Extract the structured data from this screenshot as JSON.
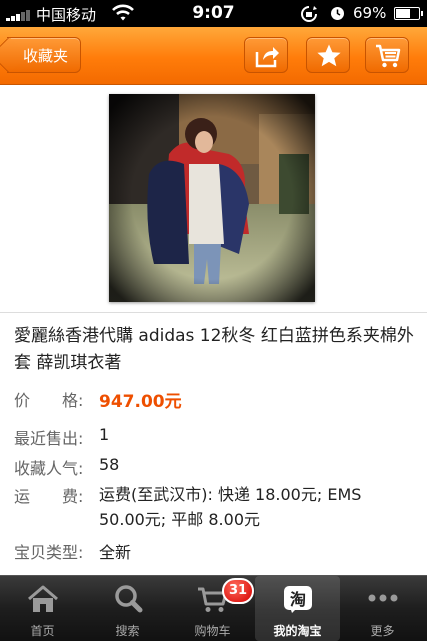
{
  "status_bar": {
    "carrier": "中国移动",
    "time": "9:07",
    "battery": "69%",
    "battery_level": 0.69
  },
  "nav": {
    "back_label": "收藏夹",
    "share_icon": "share-icon",
    "favorite_icon": "star-icon",
    "cart_icon": "cart-icon"
  },
  "product": {
    "image_icon": "product-photo",
    "title": "愛麗絲香港代購 adidas 12秋冬 红白蓝拼色系夹棉外套 薛凯琪衣著",
    "price_label": "价　　格:",
    "price": "947.00元",
    "recent_sold_label": "最近售出:",
    "recent_sold": "1",
    "favorites_label": "收藏人气:",
    "favorites": "58",
    "shipping_label": "运　　费:",
    "shipping": "运费(至武汉市): 快递 18.00元; EMS 50.00元; 平邮 8.00元",
    "type_label": "宝贝类型:",
    "type": "全新"
  },
  "tabbar": {
    "tabs": [
      {
        "label": "首页",
        "icon": "home-icon"
      },
      {
        "label": "搜索",
        "icon": "search-icon"
      },
      {
        "label": "购物车",
        "icon": "cart-icon"
      },
      {
        "label": "我的淘宝",
        "icon": "taobao-icon",
        "icon_text": "淘"
      },
      {
        "label": "更多",
        "icon": "more-icon"
      }
    ],
    "cart_badge": "31"
  },
  "colors": {
    "accent": "#ff7c0a",
    "price": "#ee4f00"
  }
}
